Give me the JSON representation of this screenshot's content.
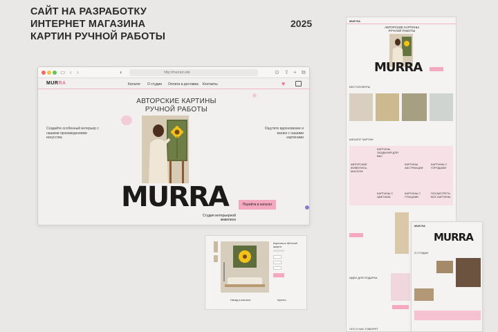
{
  "headline": "Сайт на разработку интернет магазина картин ручной работы",
  "year": "2025",
  "browser": {
    "url": "http://murrart.site",
    "logo_main": "MUR",
    "logo_accent": "RA",
    "nav": [
      "Каталог",
      "О студии",
      "Оплата и доставка",
      "Контакты"
    ],
    "hero_title": "АВТОРСКИЕ КАРТИНЫ РУЧНОЙ РАБОТЫ",
    "left_text": "Создайте особенный интерьер с нашими произведениями искусства",
    "right_text": "Ощутите вдохновение и магию с нашими картинами",
    "brand": "MURRA",
    "studio": "Студия интерьерной живописи",
    "cta": "Перейти в каталог"
  },
  "product_page": {
    "title": "Картина в Жёлтый акцент",
    "left_link": "Назад в каталог",
    "right_link": "Купить"
  },
  "tall_mock": {
    "logo": "MUR RA",
    "hero_title": "АВТОРСКИЕ КАРТИНЫ РУЧНОЙ РАБОТЫ",
    "brand": "MURRA",
    "bestsellers": "БЕСТСЕЛЛЕРЫ",
    "catalog": "КАТАЛОГ КАРТИН",
    "catalog_items": [
      "АВТОРСКИЕ ЖИВОПИСЬ МАСЛОМ",
      "КАРТИНЫ ЗАЗДАНИЯ ДЛЯ ВАС",
      "КАРТИНЫ АБСТРАКЦИИ",
      "КАРТИНЫ С ГОРОДАМИ",
      "КАРТИНЫ С ЦВЕТАМИ",
      "КАРТИНЫ С ПТИЦАМИ",
      "ПОСМОТРЕТЬ ВСЕ КАРТИНЫ"
    ],
    "gift": "ИДЕИ ДЛЯ ПОДАРКА",
    "reviews": "ЧТО О НАС ГОВОРЯТ"
  },
  "about_mock": {
    "logo": "MUR RA",
    "brand": "MURRA",
    "section": "О СТУДИИ"
  },
  "colors": {
    "accent": "#f4a9c1",
    "logo_accent": "#e6739a",
    "background": "#e9e8e6"
  }
}
